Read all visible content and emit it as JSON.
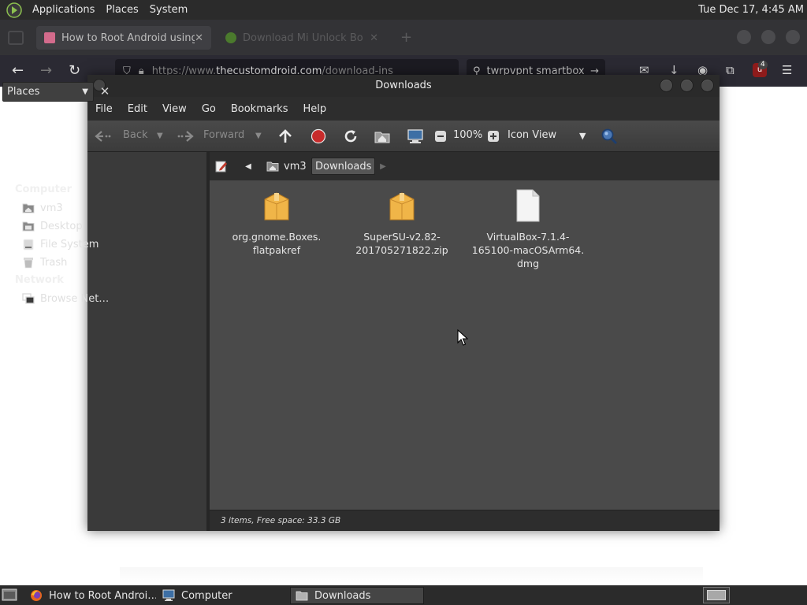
{
  "top_panel": {
    "menus": [
      "Applications",
      "Places",
      "System"
    ],
    "clock": "Tue Dec 17,  4:45 AM"
  },
  "browser": {
    "tab1_title": "How to Root Android using",
    "tab2_title": "Download Mi Unlock Bo",
    "url_prefix": "https://www.",
    "url_domain": "thecustomdroid.com",
    "url_path": "/download-ins",
    "search_text": "twrpvpnt smartbox",
    "ublock_badge": "4"
  },
  "window": {
    "title": "Downloads",
    "menu": [
      "File",
      "Edit",
      "View",
      "Go",
      "Bookmarks",
      "Help"
    ],
    "toolbar": {
      "back": "Back",
      "forward": "Forward",
      "zoom": "100%",
      "view_mode": "Icon View"
    },
    "sidebar": {
      "selector": "Places",
      "sections": [
        {
          "title": "Computer",
          "items": [
            "vm3",
            "Desktop",
            "File System",
            "Trash"
          ]
        },
        {
          "title": "Network",
          "items": [
            "Browse Net…"
          ]
        }
      ]
    },
    "path": [
      "vm3",
      "Downloads"
    ],
    "files": [
      {
        "line1": "org.gnome.Boxes.",
        "line2": "flatpakref",
        "line3": "",
        "icon": "package-icon"
      },
      {
        "line1": "SuperSU-v2.82-",
        "line2": "201705271822.zip",
        "line3": "",
        "icon": "package-icon"
      },
      {
        "line1": "VirtualBox-7.1.4-",
        "line2": "165100-macOSArm64.",
        "line3": "dmg",
        "icon": "document-icon"
      }
    ],
    "status": "3 items, Free space: 33.3 GB"
  },
  "taskbar": {
    "tasks": [
      "How to Root Androi…",
      "Computer",
      "Downloads"
    ]
  },
  "colors": {
    "panel": "#2b2b2b",
    "window_bg": "#2d2d2d",
    "content_bg": "#4a4a4a",
    "folder_orange": "#e8a73a"
  }
}
